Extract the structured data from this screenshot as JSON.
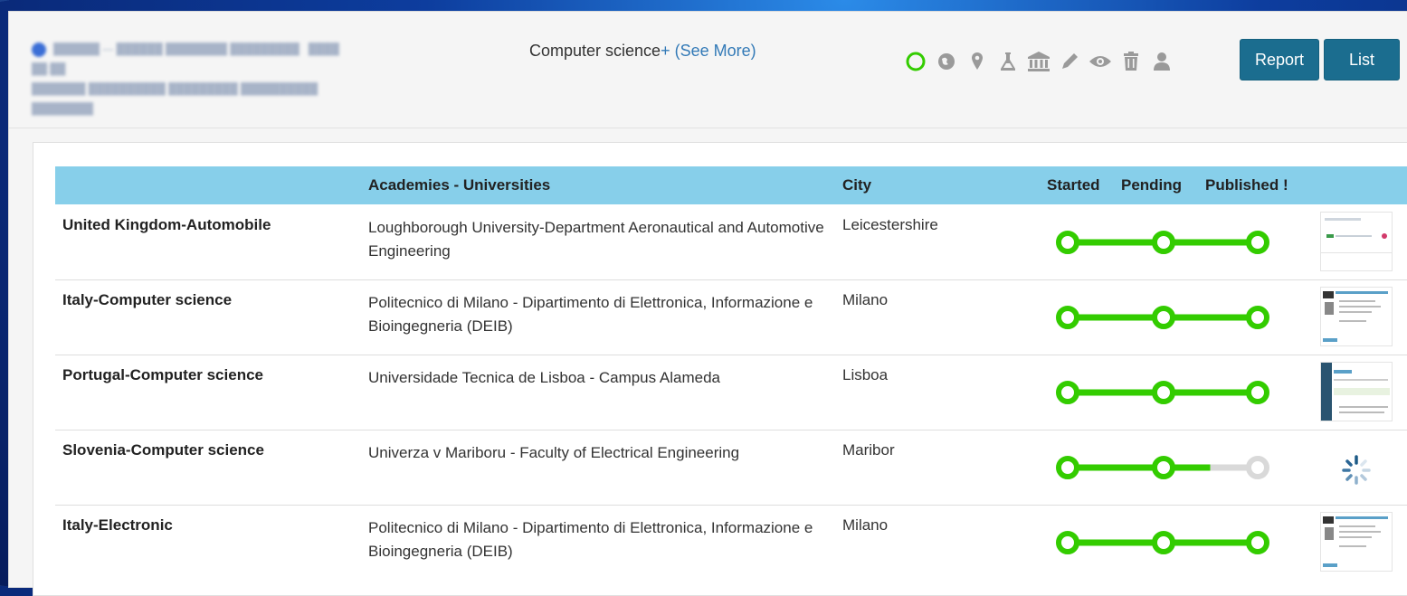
{
  "header": {
    "subject_text": "Computer science",
    "subject_plus": "+",
    "see_more": "(See More)",
    "report_label": "Report",
    "list_label": "List",
    "icons": [
      "circle-outline-icon",
      "globe-icon",
      "map-pin-icon",
      "flask-icon",
      "institution-icon",
      "pencil-icon",
      "eye-icon",
      "trash-icon",
      "user-icon"
    ],
    "colors": {
      "accent_green": "#33cc00",
      "icon_gray": "#9a9a9a",
      "button_bg": "#1b6d8f"
    }
  },
  "table": {
    "columns": {
      "academies": "Academies - Universities",
      "city": "City",
      "started": "Started",
      "pending": "Pending",
      "published": "Published !"
    },
    "header_bg": "#87cfea",
    "rows": [
      {
        "country": "United Kingdom-Automobile",
        "university": "Loughborough University-Department Aeronautical and Automotive Engineering",
        "city": "Leicestershire",
        "progress": 1.0
      },
      {
        "country": "Italy-Computer science",
        "university": "Politecnico di Milano - Dipartimento di Elettronica, Informazione e Bioingegneria (DEIB)",
        "city": "Milano",
        "progress": 1.0
      },
      {
        "country": "Portugal-Computer science",
        "university": "Universidade Tecnica de Lisboa - Campus Alameda",
        "city": "Lisboa",
        "progress": 1.0
      },
      {
        "country": "Slovenia-Computer science",
        "university": "Univerza v Mariboru - Faculty of Electrical Engineering",
        "city": "Maribor",
        "progress": 0.75
      },
      {
        "country": "Italy-Electronic",
        "university": "Politecnico di Milano - Dipartimento di Elettronica, Informazione e Bioingegneria (DEIB)",
        "city": "Milano",
        "progress": 1.0
      }
    ]
  }
}
